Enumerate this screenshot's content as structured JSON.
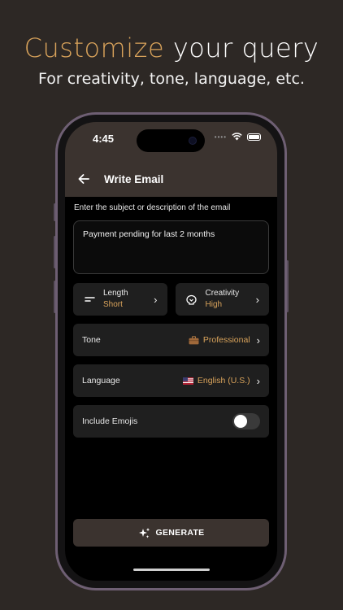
{
  "promo": {
    "title_accent": "Customize",
    "title_rest": "your query",
    "subtitle": "For creativity, tone, language, etc."
  },
  "status_bar": {
    "time": "4:45"
  },
  "header": {
    "title": "Write Email"
  },
  "form": {
    "prompt_label": "Enter the subject or description of the email",
    "subject_value": "Payment pending for last 2 months",
    "length": {
      "label": "Length",
      "value": "Short"
    },
    "creativity": {
      "label": "Creativity",
      "value": "High"
    },
    "tone": {
      "label": "Tone",
      "value": "Professional"
    },
    "language": {
      "label": "Language",
      "value": "English (U.S.)"
    },
    "emojis": {
      "label": "Include Emojis",
      "enabled": false
    }
  },
  "generate_button": {
    "label": "GENERATE"
  },
  "colors": {
    "accent": "#d9a35b",
    "header_bg": "#3b332f",
    "background": "#2d2825",
    "card": "#1f1f1f"
  },
  "icons": [
    "back-arrow-icon",
    "wifi-icon",
    "battery-icon",
    "length-icon",
    "creativity-icon",
    "briefcase-icon",
    "us-flag-icon",
    "chevron-right-icon",
    "sparkle-icon"
  ]
}
